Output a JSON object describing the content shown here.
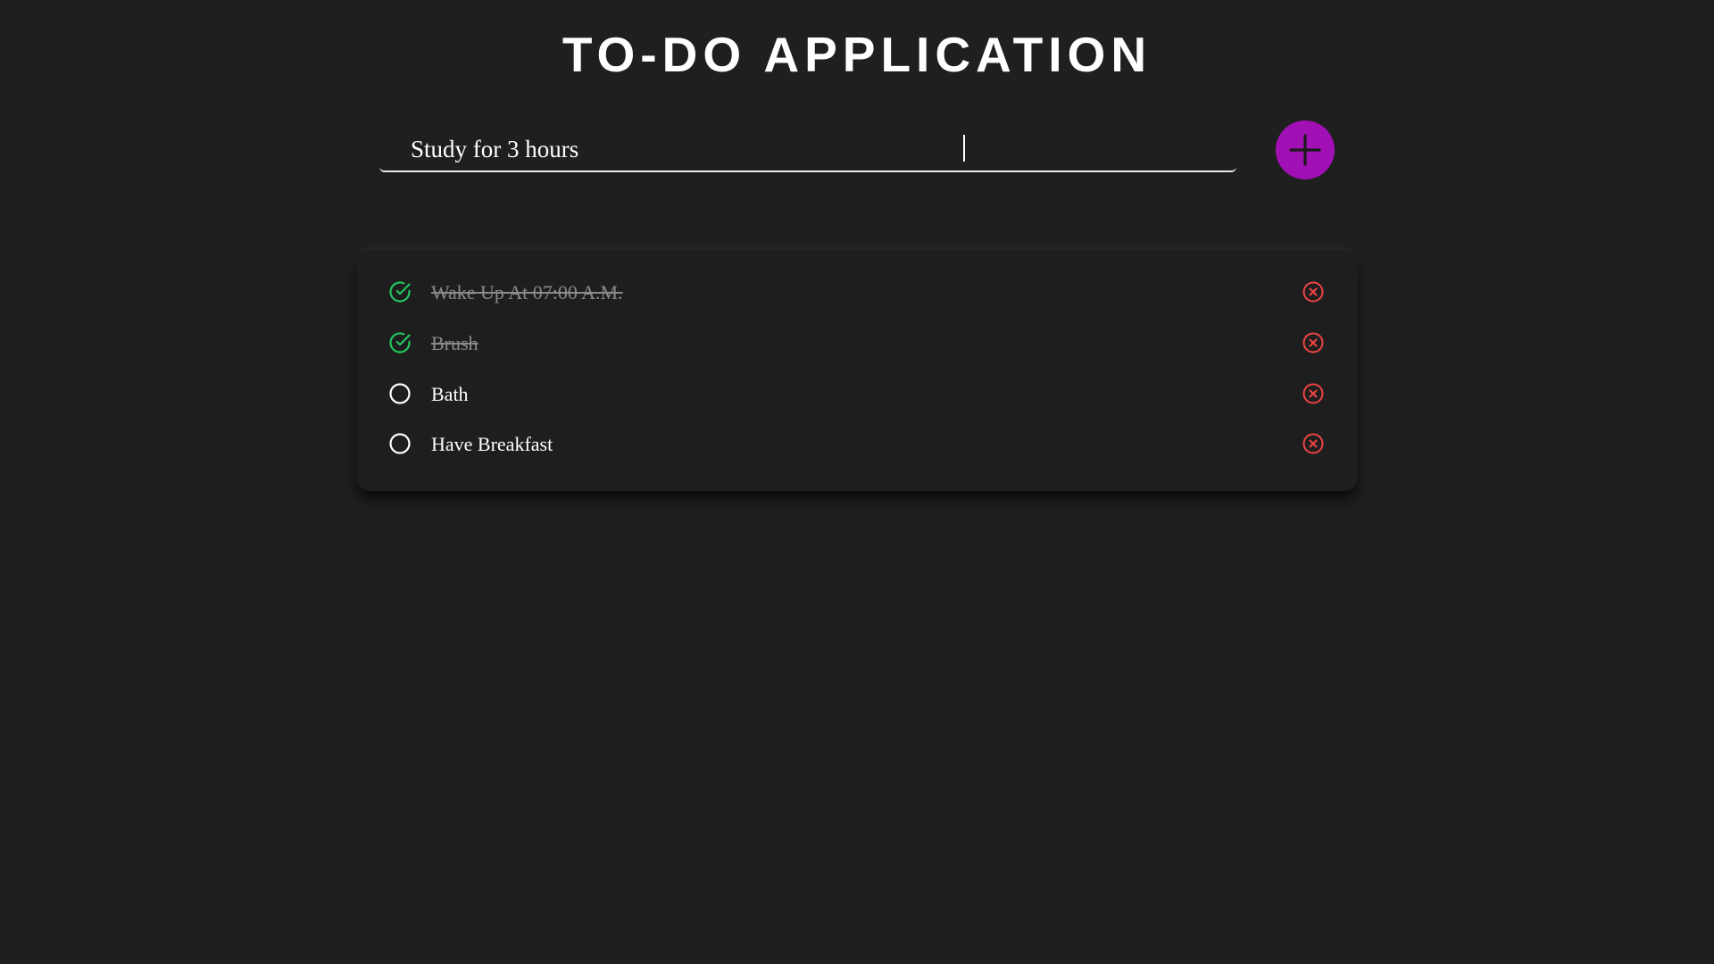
{
  "header": {
    "title": "TO-DO APPLICATION"
  },
  "input": {
    "value": "Study for 3 hours",
    "add_icon": "plus-icon"
  },
  "colors": {
    "background": "#1f1f1f",
    "accent": "#a010b4",
    "done": "#22c55e",
    "delete": "#ef4444"
  },
  "todos": [
    {
      "text": "Wake Up At 07:00 A.M.",
      "completed": true
    },
    {
      "text": "Brush",
      "completed": true
    },
    {
      "text": "Bath",
      "completed": false
    },
    {
      "text": "Have Breakfast",
      "completed": false
    }
  ]
}
